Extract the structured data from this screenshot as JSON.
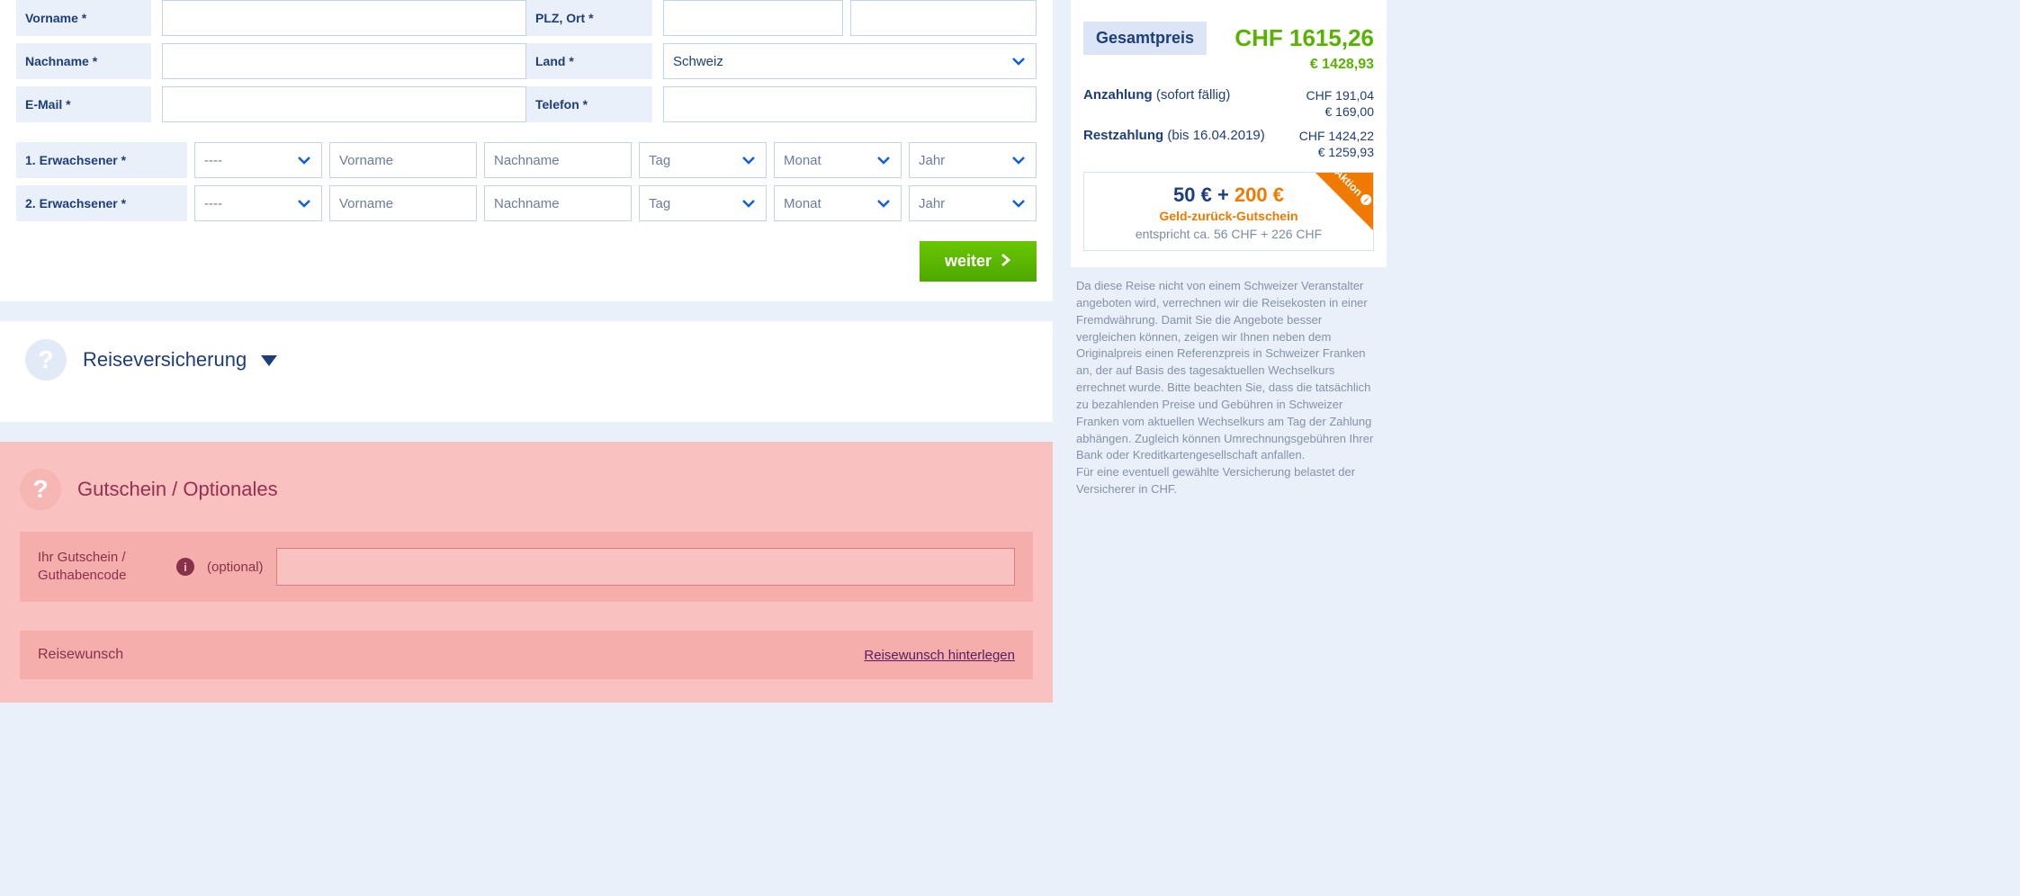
{
  "form": {
    "labels": {
      "vorname": "Vorname *",
      "nachname": "Nachname *",
      "email": "E-Mail *",
      "plzort": "PLZ, Ort *",
      "land": "Land *",
      "telefon": "Telefon *"
    },
    "country": "Schweiz"
  },
  "travellers": [
    {
      "label": "1. Erwachsener *",
      "sal": "----",
      "vn_ph": "Vorname",
      "nn_ph": "Nachname",
      "day": "Tag",
      "mon": "Monat",
      "year": "Jahr"
    },
    {
      "label": "2. Erwachsener *",
      "sal": "----",
      "vn_ph": "Vorname",
      "nn_ph": "Nachname",
      "day": "Tag",
      "mon": "Monat",
      "year": "Jahr"
    }
  ],
  "buttons": {
    "weiter": "weiter"
  },
  "ins_section": {
    "title": "Reiseversicherung"
  },
  "voucher": {
    "title": "Gutschein / Optionales",
    "code_label": "Ihr Gutschein / Guthabencode",
    "optional": "(optional)",
    "wish_label": "Reisewunsch",
    "wish_link": "Reisewunsch hinterlegen"
  },
  "summary": {
    "total_label": "Gesamtpreis",
    "total_chf": "CHF 1615,26",
    "total_eur": "€ 1428,93",
    "deposit_label": "Anzahlung",
    "deposit_note": "(sofort fällig)",
    "deposit_chf": "CHF 191,04",
    "deposit_eur": "€ 169,00",
    "rest_label": "Restzahlung",
    "rest_note": "(bis 16.04.2019)",
    "rest_chf": "CHF 1424,22",
    "rest_eur": "€ 1259,93"
  },
  "promo": {
    "p1a": "50 € + ",
    "p1b": "200 €",
    "sub": "Geld-zurück-Gutschein",
    "note": "entspricht ca. 56 CHF + 226 CHF",
    "corner": "Aktion"
  },
  "disclaimer": "Da diese Reise nicht von einem Schweizer Veranstalter angeboten wird, verrechnen wir die Reisekosten in einer Fremdwährung. Damit Sie die Angebote besser vergleichen können, zeigen wir Ihnen neben dem Originalpreis einen Referenzpreis in Schweizer Franken an, der auf Basis des tagesaktuellen Wechselkurs errechnet wurde. Bitte beachten Sie, dass die tatsächlich zu bezahlenden Preise und Gebühren in Schweizer Franken vom aktuellen Wechselkurs am Tag der Zahlung abhängen. Zugleich können Umrechnungsgebühren Ihrer Bank oder Kreditkartengesellschaft anfallen.\nFür eine eventuell gewählte Versicherung belastet der Versicherer in CHF."
}
